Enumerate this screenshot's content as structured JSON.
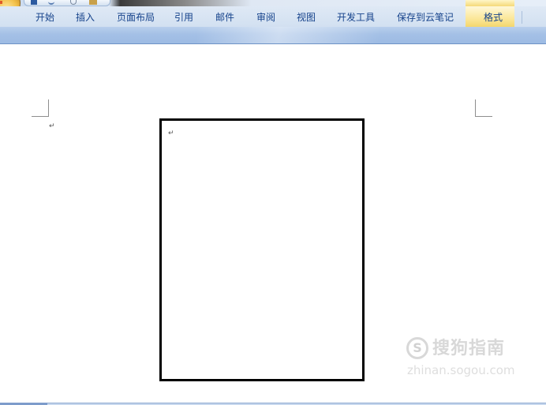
{
  "ribbon": {
    "tabs": [
      {
        "label": "开始"
      },
      {
        "label": "插入"
      },
      {
        "label": "页面布局"
      },
      {
        "label": "引用"
      },
      {
        "label": "邮件"
      },
      {
        "label": "审阅"
      },
      {
        "label": "视图"
      },
      {
        "label": "开发工具"
      },
      {
        "label": "保存到云笔记"
      },
      {
        "label": "格式"
      }
    ],
    "active_contextual_tab": "格式"
  },
  "quick_access_toolbar": {
    "icons": [
      "save-icon",
      "undo-icon",
      "repeat-icon",
      "print-preview-icon"
    ]
  },
  "document": {
    "paragraph_mark": "↵",
    "text_box_paragraph_mark": "↵"
  },
  "watermark": {
    "brand": "搜狗指南",
    "url": "zhinan.sogou.com",
    "logo_glyph": "S"
  },
  "colors": {
    "tab_text": "#15428b",
    "ribbon_band": "#a4c0e6",
    "contextual_tab_highlight": "#fbe79a",
    "frame_border": "#000000"
  }
}
